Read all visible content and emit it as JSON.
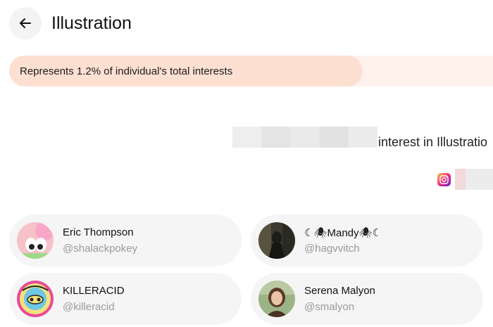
{
  "header": {
    "title": "Illustration",
    "back_icon": "arrow-left-icon"
  },
  "share_bar": {
    "text": "Represents 1.2% of individual's total interests",
    "fill_color": "#fde0d2",
    "track_color": "#fff2ec"
  },
  "interest": {
    "text": "interest in Illustratio",
    "platform_icon": "instagram-icon"
  },
  "profiles": [
    {
      "name": "Eric Thompson",
      "handle": "@shalackpokey"
    },
    {
      "name": "☾🕷Mandy🕷☾",
      "handle": "@hagvvitch"
    },
    {
      "name": "KILLERACID",
      "handle": "@killeracid"
    },
    {
      "name": "Serena Malyon",
      "handle": "@smalyon"
    }
  ]
}
